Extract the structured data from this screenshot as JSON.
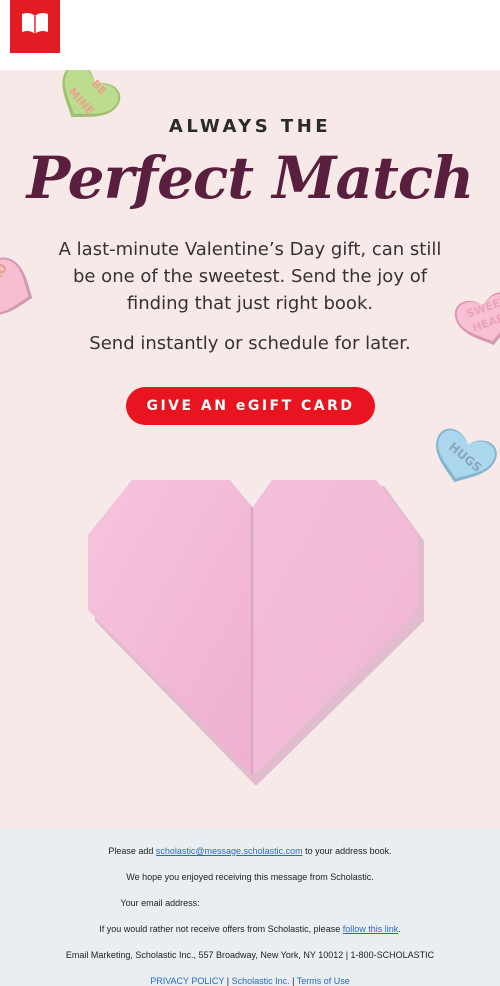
{
  "header": {
    "logo_icon": "open-book-icon",
    "brand_color": "#e31b23"
  },
  "hero": {
    "eyebrow": "ALWAYS THE",
    "title": "Perfect Match",
    "body": "A last-minute Valentine’s Day gift, can still be one of the sweetest. Send the joy of finding that just right book.",
    "body2": "Send instantly or schedule for later.",
    "cta_label": "GIVE AN eGIFT CARD",
    "cta_color": "#e8141f",
    "title_color": "#5a1f3e",
    "background": "#f7e9e8",
    "candies": [
      {
        "text_line1": "BE",
        "text_line2": "MINE",
        "color": "#b9d98a"
      },
      {
        "text_line1": "XO",
        "text_line2": "",
        "color": "#f6b9cf"
      },
      {
        "text_line1": "SWEET",
        "text_line2": "HEART",
        "color": "#f6b9cf"
      },
      {
        "text_line1": "HUGS",
        "text_line2": "",
        "color": "#a9d6ee"
      }
    ],
    "heart_color": "#f1b6d4"
  },
  "footer": {
    "add_prefix": "Please add ",
    "add_email": "scholastic@message.scholastic.com",
    "add_suffix": " to your address book.",
    "hope": "We hope you enjoyed receiving this message from Scholastic.",
    "your_email": "Your email address:",
    "optout_prefix": "If you would rather not receive offers from Scholastic, please ",
    "optout_link": "follow this link",
    "optout_suffix": ".",
    "address": "Email Marketing, Scholastic Inc., 557 Broadway, New York, NY 10012 | 1-800-SCHOLASTIC",
    "privacy": "PRIVACY POLICY",
    "sep1": " | ",
    "company": "Scholastic Inc.",
    "sep2": " | ",
    "terms": "Terms of Use",
    "background": "#e8eef1"
  }
}
